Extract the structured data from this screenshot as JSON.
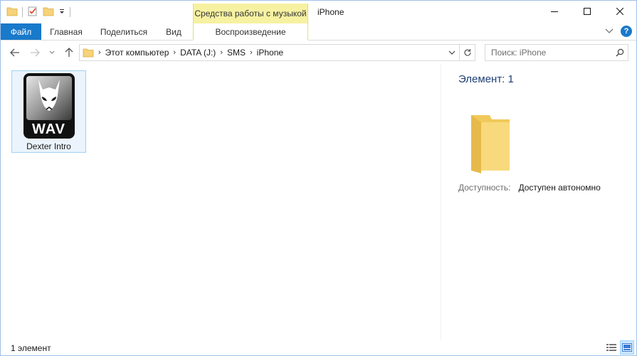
{
  "titlebar": {
    "context_group": "Средства работы с музыкой",
    "title": "iPhone",
    "icons": [
      "folder-icon",
      "properties-checkmark-icon",
      "new-folder-icon",
      "customize-qat-icon"
    ],
    "buttons": [
      "minimize-icon",
      "maximize-icon",
      "close-icon"
    ]
  },
  "ribbon": {
    "tabs": [
      {
        "label": "Файл"
      },
      {
        "label": "Главная"
      },
      {
        "label": "Поделиться"
      },
      {
        "label": "Вид"
      },
      {
        "label": "Воспроизведение"
      }
    ]
  },
  "navigation": {
    "breadcrumbs": [
      "Этот компьютер",
      "DATA (J:)",
      "SMS",
      "iPhone"
    ]
  },
  "search": {
    "placeholder": "Поиск: iPhone"
  },
  "files": [
    {
      "name": "Dexter Intro",
      "icon": "wav-file-icon",
      "badge": "WAV"
    }
  ],
  "details": {
    "title": "Элемент: 1",
    "availability_label": "Доступность:",
    "availability_value": "Доступен автономно"
  },
  "status": {
    "text": "1 элемент"
  },
  "colors": {
    "accent": "#1979ca",
    "context_tab": "#f7f2a1",
    "selection": "#ebf4fc",
    "selection_border": "#9fd1f2",
    "details_title": "#1e3f73"
  }
}
